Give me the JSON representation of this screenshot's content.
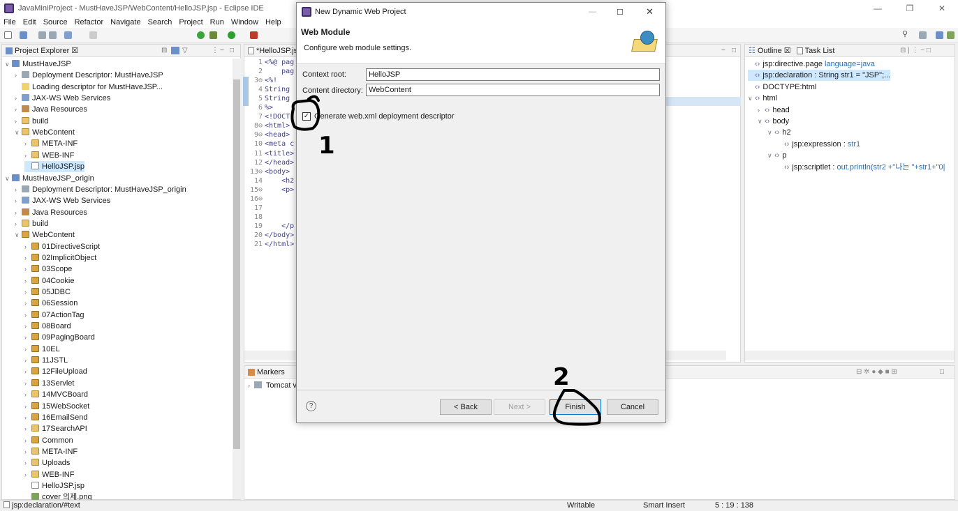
{
  "window": {
    "title": "JavaMiniProject - MustHaveJSP/WebContent/HelloJSP.jsp - Eclipse IDE"
  },
  "menu": [
    "File",
    "Edit",
    "Source",
    "Refactor",
    "Navigate",
    "Search",
    "Project",
    "Run",
    "Window",
    "Help"
  ],
  "project_explorer": {
    "title": "Project Explorer ☒",
    "rows": [
      {
        "tw": "∨",
        "label": "MustHaveJSP",
        "ic": "ic-proj",
        "indent": 0
      },
      {
        "tw": "›",
        "label": "Deployment Descriptor: MustHaveJSP",
        "ic": "ic-dd",
        "indent": 1
      },
      {
        "tw": "",
        "label": "Loading descriptor for MustHaveJSP...",
        "ic": "ic-load",
        "indent": 1
      },
      {
        "tw": "›",
        "label": "JAX-WS Web Services",
        "ic": "ic-ws",
        "indent": 1
      },
      {
        "tw": "›",
        "label": "Java Resources",
        "ic": "ic-jr",
        "indent": 1
      },
      {
        "tw": "›",
        "label": "build",
        "ic": "ic-folder",
        "indent": 1
      },
      {
        "tw": "∨",
        "label": "WebContent",
        "ic": "ic-folder",
        "indent": 1
      },
      {
        "tw": "›",
        "label": "META-INF",
        "ic": "ic-folder",
        "indent": 2
      },
      {
        "tw": "›",
        "label": "WEB-INF",
        "ic": "ic-folder",
        "indent": 2
      },
      {
        "tw": "",
        "label": "HelloJSP.jsp",
        "ic": "ic-file",
        "indent": 2,
        "selected": true
      },
      {
        "tw": "∨",
        "label": "MustHaveJSP_origin",
        "ic": "ic-proj",
        "indent": 0
      },
      {
        "tw": "›",
        "label": "Deployment Descriptor: MustHaveJSP_origin",
        "ic": "ic-dd",
        "indent": 1
      },
      {
        "tw": "›",
        "label": "JAX-WS Web Services",
        "ic": "ic-ws",
        "indent": 1
      },
      {
        "tw": "›",
        "label": "Java Resources",
        "ic": "ic-jr",
        "indent": 1
      },
      {
        "tw": "›",
        "label": "build",
        "ic": "ic-folder",
        "indent": 1
      },
      {
        "tw": "∨",
        "label": "WebContent",
        "ic": "ic-pkg",
        "indent": 1
      },
      {
        "tw": "›",
        "label": "01DirectiveScript",
        "ic": "ic-pkg",
        "indent": 2
      },
      {
        "tw": "›",
        "label": "02ImplicitObject",
        "ic": "ic-pkg",
        "indent": 2
      },
      {
        "tw": "›",
        "label": "03Scope",
        "ic": "ic-pkg",
        "indent": 2
      },
      {
        "tw": "›",
        "label": "04Cookie",
        "ic": "ic-pkg",
        "indent": 2
      },
      {
        "tw": "›",
        "label": "05JDBC",
        "ic": "ic-pkg",
        "indent": 2
      },
      {
        "tw": "›",
        "label": "06Session",
        "ic": "ic-pkg",
        "indent": 2
      },
      {
        "tw": "›",
        "label": "07ActionTag",
        "ic": "ic-pkg",
        "indent": 2
      },
      {
        "tw": "›",
        "label": "08Board",
        "ic": "ic-pkg",
        "indent": 2
      },
      {
        "tw": "›",
        "label": "09PagingBoard",
        "ic": "ic-pkg",
        "indent": 2
      },
      {
        "tw": "›",
        "label": "10EL",
        "ic": "ic-pkg",
        "indent": 2
      },
      {
        "tw": "›",
        "label": "11JSTL",
        "ic": "ic-pkg",
        "indent": 2
      },
      {
        "tw": "›",
        "label": "12FileUpload",
        "ic": "ic-pkg",
        "indent": 2
      },
      {
        "tw": "›",
        "label": "13Servlet",
        "ic": "ic-pkg",
        "indent": 2
      },
      {
        "tw": "›",
        "label": "14MVCBoard",
        "ic": "ic-folder",
        "indent": 2
      },
      {
        "tw": "›",
        "label": "15WebSocket",
        "ic": "ic-pkg",
        "indent": 2
      },
      {
        "tw": "›",
        "label": "16EmailSend",
        "ic": "ic-pkg",
        "indent": 2
      },
      {
        "tw": "›",
        "label": "17SearchAPI",
        "ic": "ic-folder",
        "indent": 2
      },
      {
        "tw": "›",
        "label": "Common",
        "ic": "ic-pkg",
        "indent": 2
      },
      {
        "tw": "›",
        "label": "META-INF",
        "ic": "ic-folder",
        "indent": 2
      },
      {
        "tw": "›",
        "label": "Uploads",
        "ic": "ic-folder",
        "indent": 2
      },
      {
        "tw": "›",
        "label": "WEB-INF",
        "ic": "ic-folder",
        "indent": 2
      },
      {
        "tw": "",
        "label": "HelloJSP.jsp",
        "ic": "ic-file",
        "indent": 2
      },
      {
        "tw": "",
        "label": "cover 의제.png",
        "ic": "ic-img",
        "indent": 2
      }
    ]
  },
  "editor": {
    "tab": "*HelloJSP.jsp",
    "lines": [
      {
        "n": "1",
        "t": "<%@ pag"
      },
      {
        "n": "2",
        "t": "    pag"
      },
      {
        "n": "3⊖",
        "t": "<%!"
      },
      {
        "n": "4",
        "t": "String"
      },
      {
        "n": "5",
        "t": "String"
      },
      {
        "n": "6",
        "t": "%>"
      },
      {
        "n": "7",
        "t": "<!DOCT"
      },
      {
        "n": "8⊖",
        "t": "<html>"
      },
      {
        "n": "9⊖",
        "t": "<head>"
      },
      {
        "n": "10",
        "t": "<meta c"
      },
      {
        "n": "11",
        "t": "<title>"
      },
      {
        "n": "12",
        "t": "</head>"
      },
      {
        "n": "13⊖",
        "t": "<body>"
      },
      {
        "n": "14",
        "t": "    <h2"
      },
      {
        "n": "15⊖",
        "t": "    <p>"
      },
      {
        "n": "16⊖",
        "t": ""
      },
      {
        "n": "17",
        "t": ""
      },
      {
        "n": "18",
        "t": ""
      },
      {
        "n": "19",
        "t": "    </p"
      },
      {
        "n": "20",
        "t": "</body>"
      },
      {
        "n": "21",
        "t": "</html>"
      }
    ]
  },
  "markers": {
    "tab": "Markers",
    "row": "Tomcat v"
  },
  "outline": {
    "tabs": [
      "Outline ☒",
      "Task List"
    ],
    "rows": [
      {
        "tw": "",
        "label": "jsp:directive.page",
        "extra": "language=java",
        "indent": 0
      },
      {
        "tw": "",
        "label": "jsp:declaration : String str1 = \"JSP\";...",
        "extra": "",
        "indent": 0,
        "selected": true
      },
      {
        "tw": "",
        "label": "DOCTYPE:html",
        "extra": "",
        "indent": 0
      },
      {
        "tw": "∨",
        "label": "html",
        "extra": "",
        "indent": 0
      },
      {
        "tw": "›",
        "label": "head",
        "extra": "",
        "indent": 1
      },
      {
        "tw": "∨",
        "label": "body",
        "extra": "",
        "indent": 1
      },
      {
        "tw": "∨",
        "label": "h2",
        "extra": "",
        "indent": 2
      },
      {
        "tw": "",
        "label": "jsp:expression : ",
        "extra": "str1",
        "indent": 3
      },
      {
        "tw": "∨",
        "label": "p",
        "extra": "",
        "indent": 2
      },
      {
        "tw": "",
        "label": "jsp:scriptlet : ",
        "extra": "out.println(str2 +\"나는 \"+str1+\"0|",
        "indent": 3
      }
    ]
  },
  "dialog": {
    "title": "New Dynamic Web Project",
    "heading": "Web Module",
    "subheading": "Configure web module settings.",
    "context_root_label": "Context root:",
    "context_root_value": "HelloJSP",
    "content_dir_label": "Content directory:",
    "content_dir_value": "WebContent",
    "checkbox_label": "Generate web.xml deployment descriptor",
    "checkbox_checked": true,
    "help": "?",
    "back": "< Back",
    "next": "Next >",
    "finish": "Finish",
    "cancel": "Cancel"
  },
  "annotations": {
    "step1": "1",
    "step2": "2"
  },
  "statusbar": {
    "path": "jsp:declaration/#text",
    "mode": "Writable",
    "insert": "Smart Insert",
    "position": "5 : 19 : 138"
  }
}
